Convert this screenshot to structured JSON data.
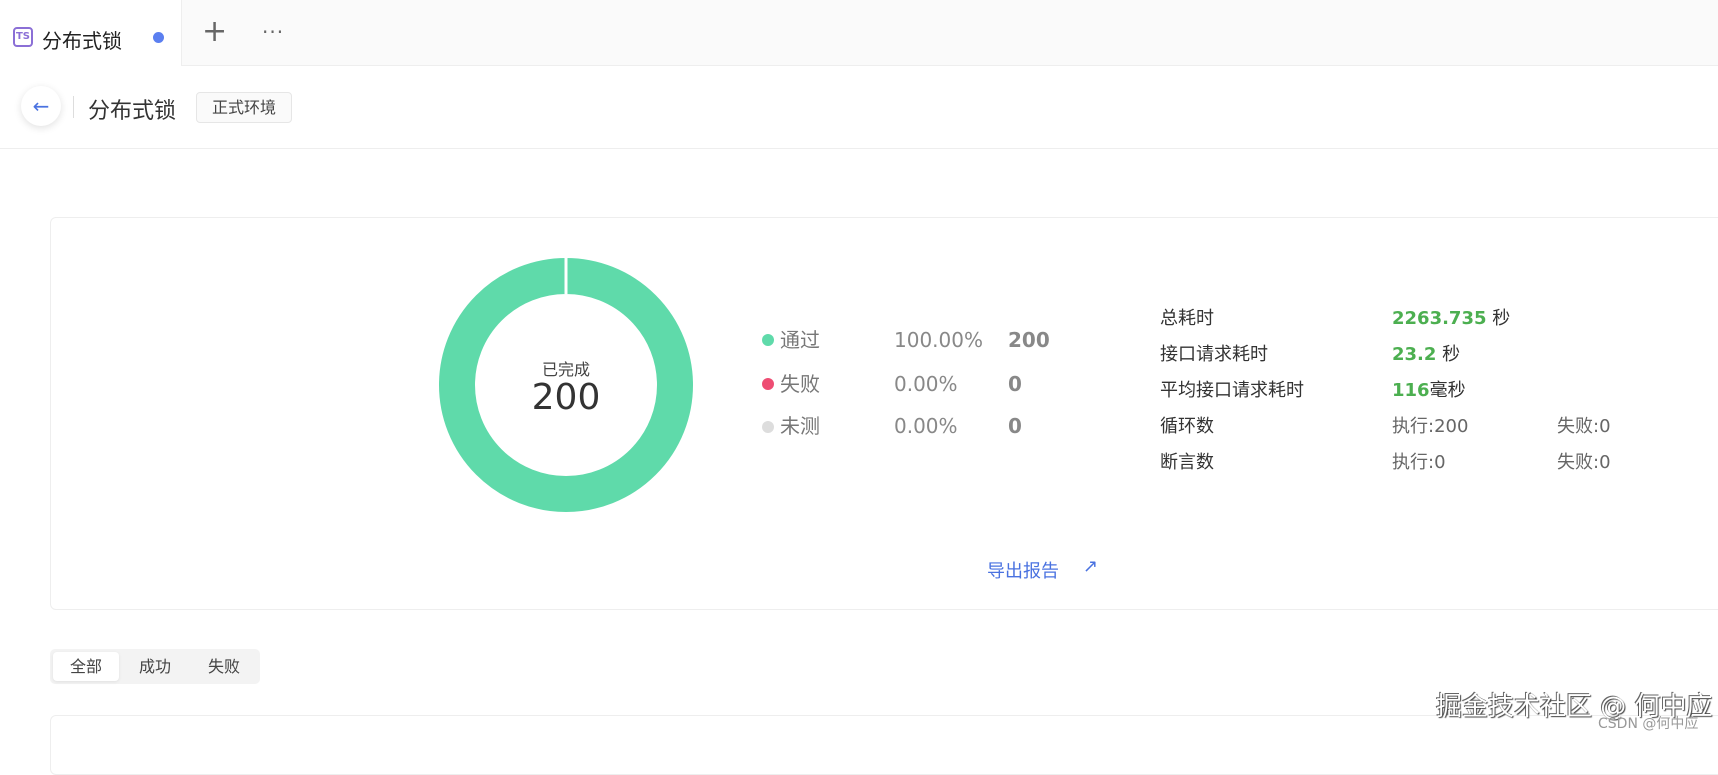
{
  "tabbar": {
    "tab_icon": "TS",
    "tab_title": "分布式锁",
    "plus": "+",
    "more": "···"
  },
  "header": {
    "back": "←",
    "title": "分布式锁",
    "env_tag": "正式环境"
  },
  "summary": {
    "center_label": "已完成",
    "center_value": "200",
    "colors": {
      "pass": "#5fdaaa",
      "fail": "#ee4d73",
      "untested": "#dddddd"
    },
    "legend": [
      {
        "label": "通过",
        "percent": "100.00%",
        "count": "200"
      },
      {
        "label": "失败",
        "percent": "0.00%",
        "count": "0"
      },
      {
        "label": "未测",
        "percent": "0.00%",
        "count": "0"
      }
    ],
    "stats": {
      "total_time": {
        "label": "总耗时",
        "value": "2263.735",
        "unit": " 秒"
      },
      "api_time": {
        "label": "接口请求耗时",
        "value": "23.2",
        "unit": " 秒"
      },
      "avg_time": {
        "label": "平均接口请求耗时",
        "value": "116",
        "unit": "毫秒"
      },
      "loops": {
        "label": "循环数",
        "exec": "执行:200",
        "fail": "失败:0"
      },
      "asserts": {
        "label": "断言数",
        "exec": "执行:0",
        "fail": "失败:0"
      }
    },
    "export": "导出报告",
    "export_icon": "↗"
  },
  "filter": {
    "items": [
      "全部",
      "成功",
      "失败"
    ]
  },
  "watermark": {
    "main": "掘金技术社区 @ 何中应",
    "sub": "CSDN @何中应"
  }
}
